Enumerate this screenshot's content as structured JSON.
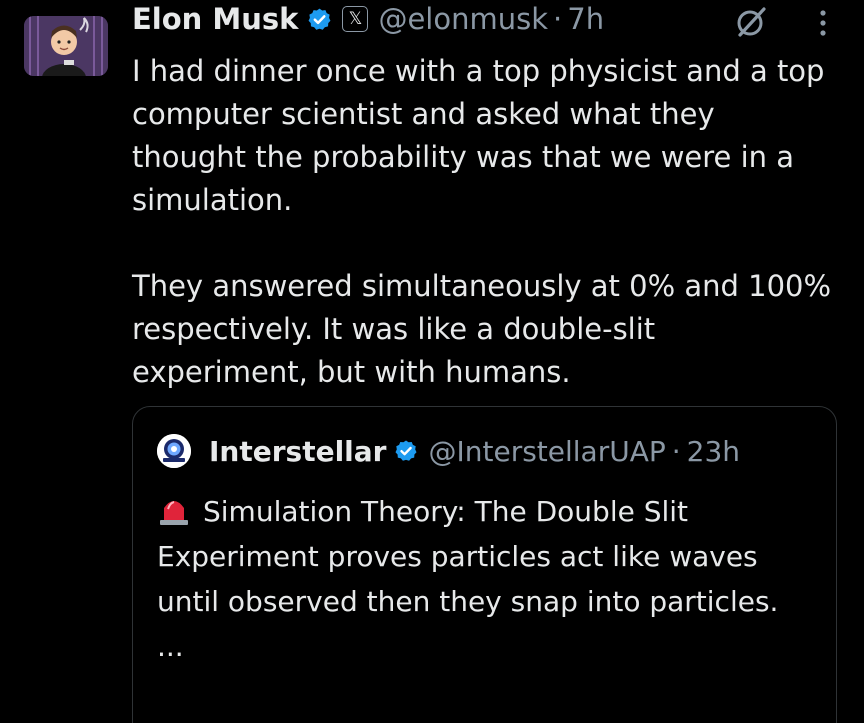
{
  "tweet": {
    "author_name": "Elon Musk",
    "affiliate_badge": "𝕏",
    "handle": "@elonmusk",
    "separator": "·",
    "time": "7h",
    "paragraph_1": "I had dinner once with a top physicist and a top computer scientist and asked what they thought the probability was that we were in a simulation.",
    "paragraph_2": "They answered simultaneously at 0% and 100% respectively. It was like a double-slit experiment, but with humans."
  },
  "quoted_tweet": {
    "author_name": "Interstellar",
    "handle": "@InterstellarUAP",
    "separator": "·",
    "time": "23h",
    "text": "Simulation Theory:  The Double Slit Experiment proves particles act like waves until observed then they snap into particles.",
    "ellipsis": "..."
  },
  "icons": {
    "verified": "verified-check-icon",
    "affiliate": "x-logo-badge-icon",
    "grok": "grok-icon",
    "more": "more-vertical-icon",
    "siren": "rotating-light-icon"
  },
  "colors": {
    "background": "#000000",
    "text_primary": "#e7e9ea",
    "text_secondary": "#8b98a5",
    "verified_blue": "#1d9bf0",
    "border": "#2f3336"
  }
}
